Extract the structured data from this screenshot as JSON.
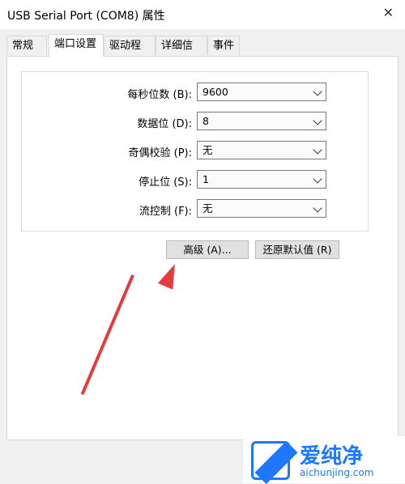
{
  "window": {
    "title": "USB Serial Port (COM8) 属性",
    "close_icon": "close-icon"
  },
  "tabs": [
    "常规",
    "端口设置",
    "驱动程序",
    "详细信息",
    "事件"
  ],
  "settings": {
    "rows": [
      {
        "label": "每秒位数 (B):",
        "value": "9600"
      },
      {
        "label": "数据位 (D):",
        "value": "8"
      },
      {
        "label": "奇偶校验 (P):",
        "value": "无"
      },
      {
        "label": "停止位 (S):",
        "value": "1"
      },
      {
        "label": "流控制 (F):",
        "value": "无"
      }
    ]
  },
  "buttons": {
    "advanced": "高级 (A)...",
    "restore": "还原默认值 (R)"
  },
  "watermark": {
    "cn": "爱纯净",
    "en": "aichunjing.com"
  },
  "colors": {
    "accent_red": "#e43b3b",
    "watermark_blue": "#1d78ff"
  }
}
